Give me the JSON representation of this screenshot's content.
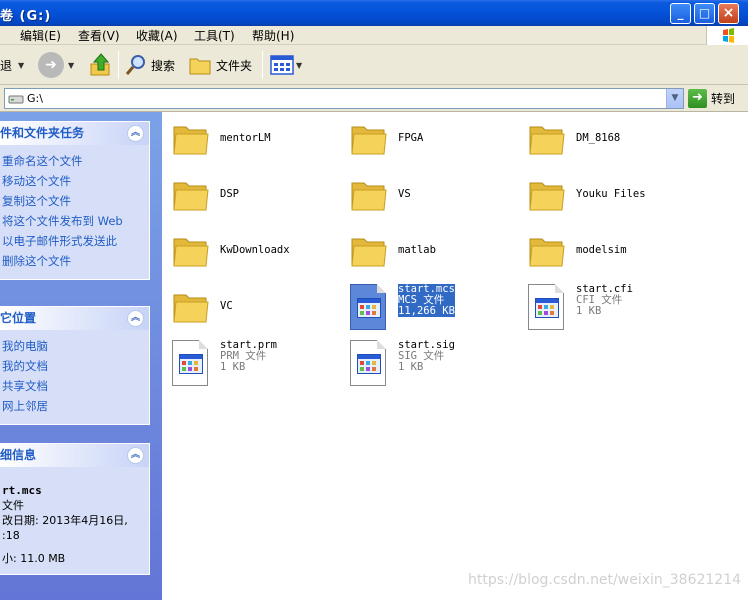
{
  "window": {
    "title": "卷 (G:)"
  },
  "menu": [
    "编辑(E)",
    "查看(V)",
    "收藏(A)",
    "工具(T)",
    "帮助(H)"
  ],
  "toolbar": {
    "back_label": "退",
    "search_label": "搜索",
    "folders_label": "文件夹"
  },
  "address": {
    "path": "G:\\",
    "go_label": "转到"
  },
  "tasks_panel": {
    "title": "件和文件夹任务",
    "links": [
      "重命名这个文件",
      "移动这个文件",
      "复制这个文件",
      "将这个文件发布到 Web",
      "以电子邮件形式发送此",
      "删除这个文件"
    ]
  },
  "places_panel": {
    "title": "它位置",
    "links": [
      "我的电脑",
      "我的文档",
      "共享文档",
      "网上邻居"
    ]
  },
  "details_panel": {
    "title": "细信息",
    "name": "rt.mcs",
    "type": "文件",
    "modified_label": "改日期: 2013年4月16日,",
    "time": ":18",
    "size": "小: 11.0 MB"
  },
  "folders": [
    "mentorLM",
    "FPGA",
    "DM_8168",
    "DSP",
    "VS",
    "Youku Files",
    "KwDownloadx",
    "matlab",
    "modelsim",
    "VC"
  ],
  "files": [
    {
      "name": "start.mcs",
      "type": "MCS 文件",
      "size": "11,266 KB",
      "selected": true
    },
    {
      "name": "start.cfi",
      "type": "CFI 文件",
      "size": "1 KB",
      "selected": false
    },
    {
      "name": "start.prm",
      "type": "PRM 文件",
      "size": "1 KB",
      "selected": false
    },
    {
      "name": "start.sig",
      "type": "SIG 文件",
      "size": "1 KB",
      "selected": false
    }
  ],
  "watermark": "https://blog.csdn.net/weixin_38621214",
  "colors": {
    "title_blue": "#0553d8",
    "panel_bg": "#d6dff7",
    "link_blue": "#215dc6",
    "selection": "#316ac5",
    "folder_yellow": "#f5d35a"
  }
}
